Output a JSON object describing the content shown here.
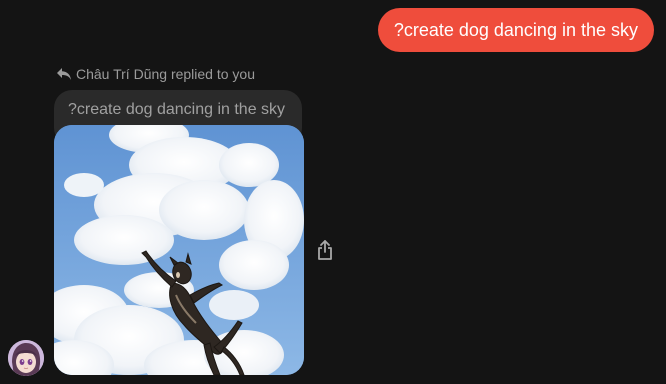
{
  "outgoing_message": {
    "text": "?create dog dancing in the sky"
  },
  "reply": {
    "notice": "Châu Trí Dũng replied to you",
    "quoted_text": "?create dog dancing in the sky",
    "image_alt": "dog dancing in the sky",
    "icon": "reply-arrow-icon"
  },
  "actions": {
    "share_icon": "share-icon"
  },
  "colors": {
    "background": "#141414",
    "outgoing_bubble": "#ef4d3c",
    "quoted_bubble": "#2a2a2a",
    "muted_text": "#9b9b9b"
  }
}
